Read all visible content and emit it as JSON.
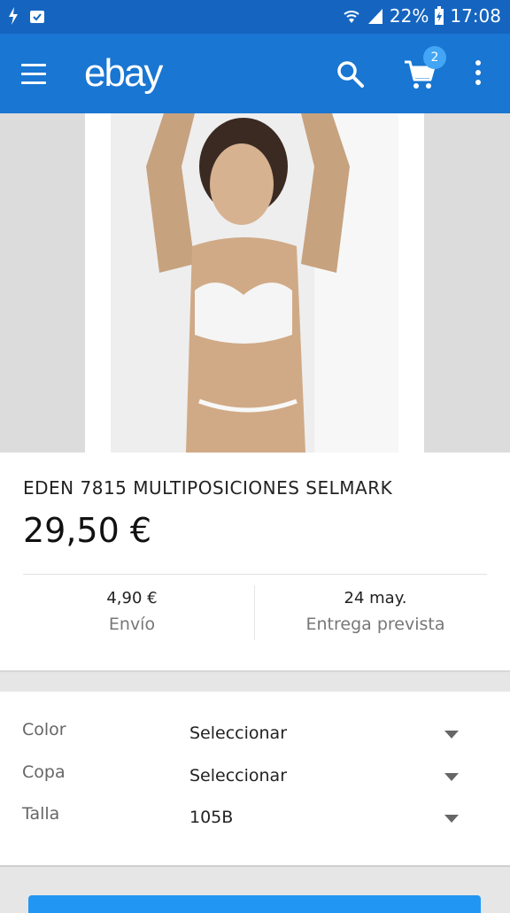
{
  "status": {
    "battery_percent": "22%",
    "time": "17:08",
    "icons": [
      "flash-icon",
      "clipboard-check-icon",
      "wifi-icon",
      "signal-icon",
      "battery-charging-icon"
    ]
  },
  "appbar": {
    "logo": "ebay",
    "cart_count": "2"
  },
  "product": {
    "title": "EDEN 7815 MULTIPOSICIONES SELMARK",
    "price": "29,50 €",
    "shipping_value": "4,90 €",
    "shipping_label": "Envío",
    "delivery_value": "24 may.",
    "delivery_label": "Entrega prevista"
  },
  "options": [
    {
      "name": "Color",
      "value": "Seleccionar"
    },
    {
      "name": "Copa",
      "value": "Seleccionar"
    },
    {
      "name": "Talla",
      "value": "105B"
    }
  ],
  "colors": {
    "statusbar": "#1565c0",
    "appbar": "#1976d2",
    "badge": "#42a5f5",
    "button": "#2196f3"
  }
}
